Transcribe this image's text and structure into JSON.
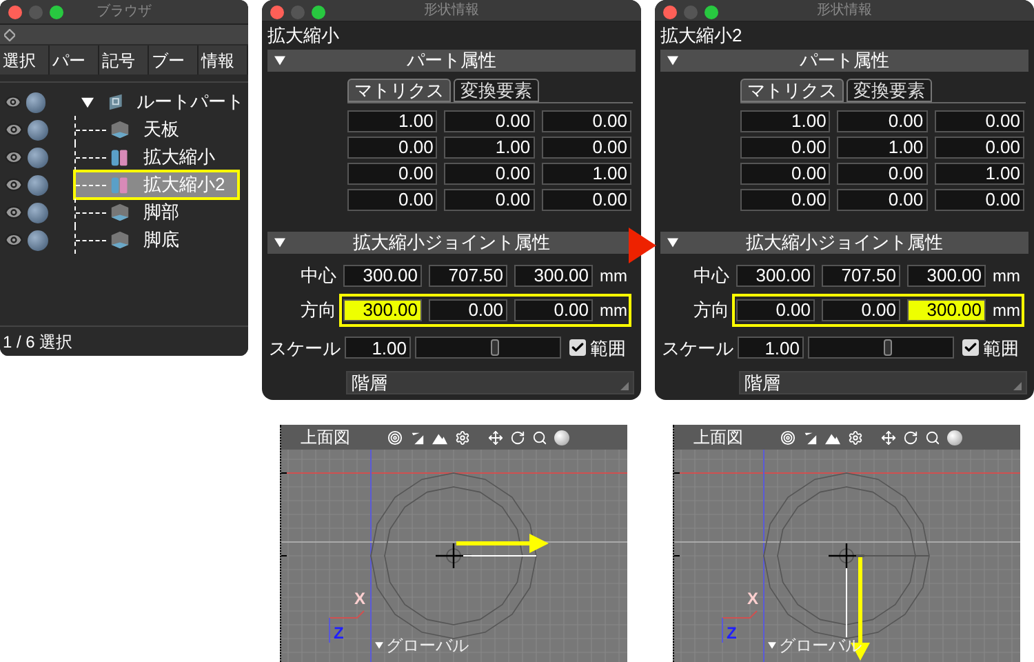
{
  "browser": {
    "title": "ブラウザ",
    "columns": [
      "選択",
      "パー",
      "記号",
      "ブー",
      "情報"
    ],
    "tree": [
      {
        "label": "ルートパート",
        "kind": "part",
        "expanded": true,
        "selected": false,
        "children": [
          {
            "label": "天板",
            "kind": "box",
            "selected": false
          },
          {
            "label": "拡大縮小",
            "kind": "joint",
            "selected": false
          },
          {
            "label": "拡大縮小2",
            "kind": "joint",
            "selected": true
          },
          {
            "label": "脚部",
            "kind": "box",
            "selected": false
          },
          {
            "label": "脚底",
            "kind": "box",
            "selected": false
          }
        ]
      }
    ],
    "status": "1 / 6 選択"
  },
  "panels": [
    {
      "title": "形状情報",
      "name": "拡大縮小",
      "section_1": "パート属性",
      "tabs": [
        {
          "label": "マトリクス",
          "selected": true
        },
        {
          "label": "変換要素",
          "selected": false
        }
      ],
      "matrix": [
        [
          "1.00",
          "0.00",
          "0.00"
        ],
        [
          "0.00",
          "1.00",
          "0.00"
        ],
        [
          "0.00",
          "0.00",
          "1.00"
        ],
        [
          "0.00",
          "0.00",
          "0.00"
        ]
      ],
      "section_2": "拡大縮小ジョイント属性",
      "joint_rows": [
        {
          "label": "中心",
          "values": [
            {
              "text": "300.00",
              "selected": false
            },
            {
              "text": "707.50",
              "selected": false
            },
            {
              "text": "300.00",
              "selected": false
            }
          ],
          "unit": "mm",
          "highlight": false
        },
        {
          "label": "方向",
          "values": [
            {
              "text": "300.00",
              "selected": true
            },
            {
              "text": "0.00",
              "selected": false
            },
            {
              "text": "0.00",
              "selected": false
            }
          ],
          "unit": "mm",
          "highlight": true
        }
      ],
      "scale": {
        "label": "スケール",
        "value": "1.00",
        "level": 0.55
      },
      "range": {
        "label": "範囲",
        "checked": true
      },
      "dropdown": "階層"
    },
    {
      "title": "形状情報",
      "name": "拡大縮小2",
      "section_1": "パート属性",
      "tabs": [
        {
          "label": "マトリクス",
          "selected": true
        },
        {
          "label": "変換要素",
          "selected": false
        }
      ],
      "matrix": [
        [
          "1.00",
          "0.00",
          "0.00"
        ],
        [
          "0.00",
          "1.00",
          "0.00"
        ],
        [
          "0.00",
          "0.00",
          "1.00"
        ],
        [
          "0.00",
          "0.00",
          "0.00"
        ]
      ],
      "section_2": "拡大縮小ジョイント属性",
      "joint_rows": [
        {
          "label": "中心",
          "values": [
            {
              "text": "300.00",
              "selected": false
            },
            {
              "text": "707.50",
              "selected": false
            },
            {
              "text": "300.00",
              "selected": false
            }
          ],
          "unit": "mm",
          "highlight": false
        },
        {
          "label": "方向",
          "values": [
            {
              "text": "0.00",
              "selected": false
            },
            {
              "text": "0.00",
              "selected": false
            },
            {
              "text": "300.00",
              "selected": true
            }
          ],
          "unit": "mm",
          "highlight": true
        }
      ],
      "scale": {
        "label": "スケール",
        "value": "1.00",
        "level": 0.55
      },
      "range": {
        "label": "範囲",
        "checked": true
      },
      "dropdown": "階層"
    }
  ],
  "viewports": [
    {
      "view": "上面図",
      "coordinate": "グローバル",
      "x_axis": "X",
      "z_axis": "Z",
      "kind": "right"
    },
    {
      "view": "上面図",
      "coordinate": "グローバル",
      "x_axis": "X",
      "z_axis": "Z",
      "kind": "down"
    }
  ]
}
